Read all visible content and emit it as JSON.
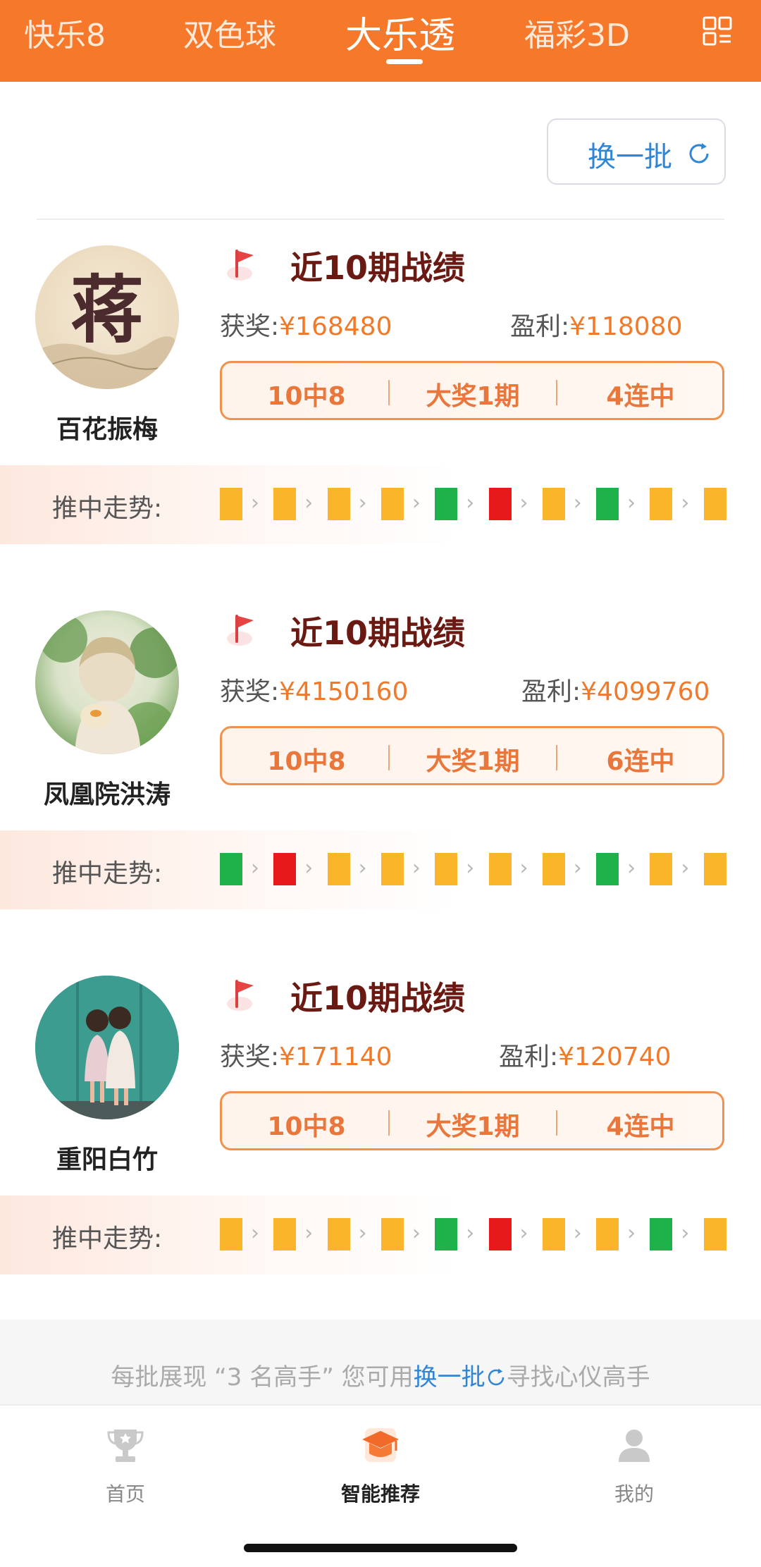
{
  "tabs": [
    {
      "label": "快乐8",
      "active": false
    },
    {
      "label": "双色球",
      "active": false
    },
    {
      "label": "大乐透",
      "active": true
    },
    {
      "label": "福彩3D",
      "active": false
    }
  ],
  "refresh_button": {
    "label": "换一批"
  },
  "experts": [
    {
      "name": "百花振梅",
      "avatar_text": "蒋",
      "record_title": "近10期战绩",
      "award_label": "获奖:",
      "award_value": "¥168480",
      "profit_label": "盈利:",
      "profit_value": "¥118080",
      "stats": [
        "10中8",
        "大奖1期",
        "4连中"
      ],
      "trend_label": "推中走势:",
      "trend": [
        "yellow",
        "yellow",
        "yellow",
        "yellow",
        "green",
        "red",
        "yellow",
        "green",
        "yellow",
        "yellow"
      ]
    },
    {
      "name": "凤凰院洪涛",
      "record_title": "近10期战绩",
      "award_label": "获奖:",
      "award_value": "¥4150160",
      "profit_label": "盈利:",
      "profit_value": "¥4099760",
      "stats": [
        "10中8",
        "大奖1期",
        "6连中"
      ],
      "trend_label": "推中走势:",
      "trend": [
        "green",
        "red",
        "yellow",
        "yellow",
        "yellow",
        "yellow",
        "yellow",
        "green",
        "yellow",
        "yellow"
      ]
    },
    {
      "name": "重阳白竹",
      "record_title": "近10期战绩",
      "award_label": "获奖:",
      "award_value": "¥171140",
      "profit_label": "盈利:",
      "profit_value": "¥120740",
      "stats": [
        "10中8",
        "大奖1期",
        "4连中"
      ],
      "trend_label": "推中走势:",
      "trend": [
        "yellow",
        "yellow",
        "yellow",
        "yellow",
        "green",
        "red",
        "yellow",
        "yellow",
        "green",
        "yellow"
      ]
    }
  ],
  "trend_colors": {
    "yellow": "#fbb52a",
    "green": "#1fb14a",
    "red": "#e8191b"
  },
  "footer_note": {
    "prefix": "每批展现 “3 名高手” 您可用",
    "link": "换一批",
    "suffix": "寻找心仪高手"
  },
  "bottom_nav": [
    {
      "label": "首页",
      "icon": "trophy-icon",
      "active": false
    },
    {
      "label": "智能推荐",
      "icon": "graduation-cap-icon",
      "active": true
    },
    {
      "label": "我的",
      "icon": "user-icon",
      "active": false
    }
  ],
  "accent_color": "#f6782a"
}
